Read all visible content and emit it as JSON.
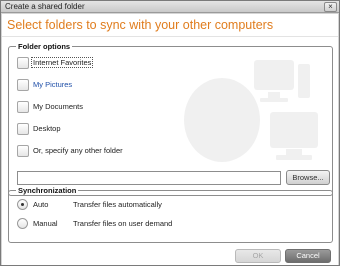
{
  "window": {
    "title": "Create a shared folder",
    "close_label": "×"
  },
  "heading": "Select folders to sync with your other computers",
  "folder_options": {
    "legend": "Folder options",
    "items": [
      {
        "label": "Internet Favorites",
        "checked": false,
        "focused": true
      },
      {
        "label": "My Pictures",
        "checked": false,
        "focused": false
      },
      {
        "label": "My Documents",
        "checked": false,
        "focused": false
      },
      {
        "label": "Desktop",
        "checked": false,
        "focused": false
      },
      {
        "label": "Or, specify any other folder",
        "checked": false,
        "focused": false
      }
    ],
    "path_value": "",
    "browse_label": "Browse..."
  },
  "synchronization": {
    "legend": "Synchronization",
    "options": [
      {
        "label": "Auto",
        "description": "Transfer files automatically",
        "selected": true
      },
      {
        "label": "Manual",
        "description": "Transfer files on user demand",
        "selected": false
      }
    ]
  },
  "buttons": {
    "ok_label": "OK",
    "cancel_label": "Cancel"
  },
  "colors": {
    "heading": "#e07d1e",
    "link": "#1f4fa8"
  }
}
